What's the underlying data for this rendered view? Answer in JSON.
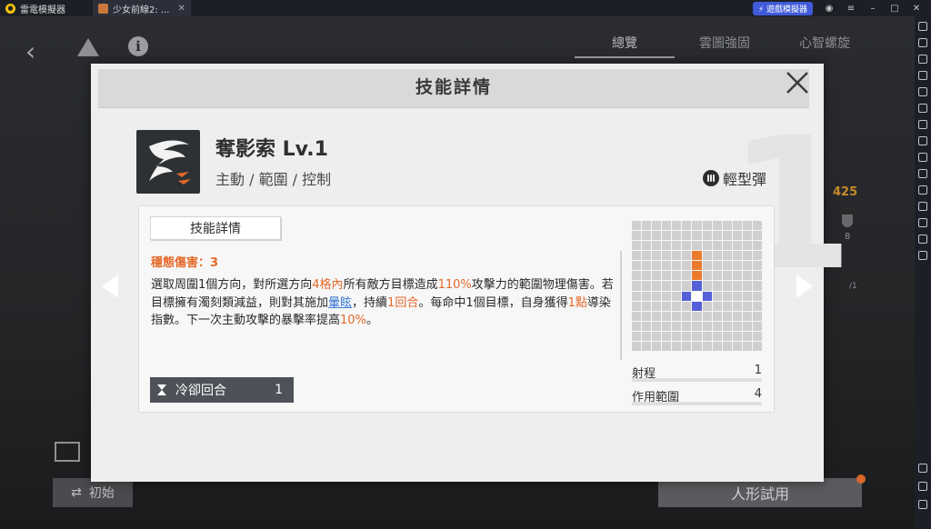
{
  "window": {
    "app_name": "雷電模擬器",
    "tab_title": "少女前線2: ...",
    "accelerate_label": "⚡ 遊戲模擬器"
  },
  "game_bg": {
    "tabs": [
      "總覽",
      "雲圖強固",
      "心智螺旋"
    ],
    "counter_425": "425",
    "counter_8": "8",
    "counter_1": "/1",
    "start_label": "初始",
    "trial_label": "人形試用"
  },
  "dialog": {
    "title": "技能詳情",
    "big_number": "1",
    "skill_name": "奪影索 Lv.1",
    "skill_tags": "主動 / 範圍 / 控制",
    "ammo_label": "輕型彈",
    "detail_tab": "技能詳情",
    "stable_damage": "穩態傷害：3",
    "desc": [
      {
        "t": "選取周圍1個方向，對所選方向",
        "c": ""
      },
      {
        "t": "4格內",
        "c": "hl"
      },
      {
        "t": "所有敵方目標造成",
        "c": ""
      },
      {
        "t": "110%",
        "c": "hl"
      },
      {
        "t": "攻擊力的範圍物理傷害。若目標擁有濁刻類減益，則對其施加",
        "c": ""
      },
      {
        "t": "暈眩",
        "c": "link"
      },
      {
        "t": "，持續",
        "c": ""
      },
      {
        "t": "1回合",
        "c": "hl"
      },
      {
        "t": "。每命中1個目標，自身獲得",
        "c": ""
      },
      {
        "t": "1點",
        "c": "hl"
      },
      {
        "t": "導染指數。下一次主動攻擊的暴擊率提高",
        "c": ""
      },
      {
        "t": "10%",
        "c": "hl"
      },
      {
        "t": "。",
        "c": ""
      }
    ],
    "cooldown_label": "冷卻回合",
    "cooldown_value": "1",
    "range_label": "射程",
    "range_value": "1",
    "area_label": "作用範圍",
    "area_value": "4",
    "grid": {
      "size": 13,
      "orange": [
        [
          6,
          3
        ],
        [
          6,
          4
        ],
        [
          6,
          5
        ]
      ],
      "blue": [
        [
          6,
          6
        ],
        [
          5,
          7
        ],
        [
          7,
          7
        ],
        [
          6,
          8
        ]
      ],
      "white": [
        [
          6,
          7
        ]
      ]
    },
    "colors": {
      "highlight": "#e46a2a",
      "link": "#3a7bd5",
      "blue_cell": "#5560d8",
      "orange_cell": "#ec7a2c"
    }
  }
}
